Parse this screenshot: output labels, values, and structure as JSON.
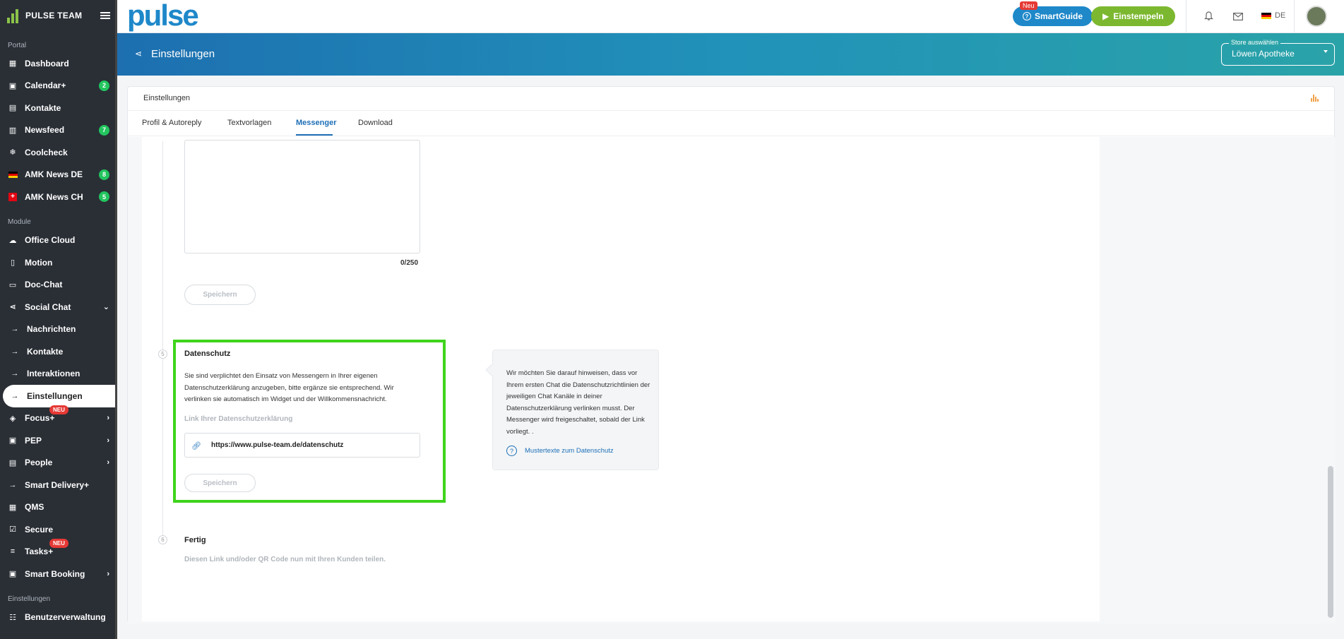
{
  "sidebar": {
    "brand": "PULSE TEAM",
    "sections": {
      "portal": "Portal",
      "module": "Module",
      "settings": "Einstellungen"
    },
    "portal_items": [
      {
        "label": "Dashboard",
        "icon": "dashboard-icon"
      },
      {
        "label": "Calendar+",
        "icon": "calendar-icon",
        "badge": "2"
      },
      {
        "label": "Kontakte",
        "icon": "contacts-icon"
      },
      {
        "label": "Newsfeed",
        "icon": "newsfeed-icon",
        "badge": "7"
      },
      {
        "label": "Coolcheck",
        "icon": "snowflake-icon"
      },
      {
        "label": "AMK News DE",
        "icon": "flag-de-icon",
        "badge": "8"
      },
      {
        "label": "AMK News CH",
        "icon": "flag-ch-icon",
        "badge": "5"
      }
    ],
    "module_items": [
      {
        "label": "Office Cloud",
        "icon": "cloud-icon"
      },
      {
        "label": "Motion",
        "icon": "phone-icon"
      },
      {
        "label": "Doc-Chat",
        "icon": "chat-icon"
      },
      {
        "label": "Social Chat",
        "icon": "share-icon"
      },
      {
        "label": "Nachrichten",
        "icon": "arrow-right-icon"
      },
      {
        "label": "Kontakte",
        "icon": "arrow-right-icon"
      },
      {
        "label": "Interaktionen",
        "icon": "arrow-right-icon"
      },
      {
        "label": "Einstellungen",
        "icon": "arrow-right-icon"
      },
      {
        "label": "Focus+",
        "icon": "focus-icon",
        "new": "NEU"
      },
      {
        "label": "PEP",
        "icon": "pep-icon"
      },
      {
        "label": "People",
        "icon": "people-icon"
      },
      {
        "label": "Smart Delivery+",
        "icon": "arrow-right-icon"
      },
      {
        "label": "QMS",
        "icon": "qms-icon"
      },
      {
        "label": "Secure",
        "icon": "secure-icon"
      },
      {
        "label": "Tasks+",
        "icon": "tasks-icon",
        "new": "NEU"
      },
      {
        "label": "Smart Booking",
        "icon": "booking-icon"
      }
    ],
    "settings_items": [
      {
        "label": "Benutzerverwaltung",
        "icon": "users-icon"
      }
    ]
  },
  "topbar": {
    "logo": "pulse",
    "smartguide_label": "SmartGuide",
    "smartguide_badge": "Neu",
    "clock_in_label": "Einstempeln",
    "language": "DE"
  },
  "header": {
    "title": "Einstellungen",
    "store_label": "Store auswählen",
    "store_value": "Löwen Apotheke"
  },
  "card": {
    "title": "Einstellungen",
    "tabs": [
      {
        "label": "Profil & Autoreply"
      },
      {
        "label": "Textvorlagen"
      },
      {
        "label": "Messenger",
        "active": true
      },
      {
        "label": "Download"
      }
    ]
  },
  "messenger": {
    "counter": "0/250",
    "save_label": "Speichern",
    "privacy": {
      "step": "5",
      "title": "Datenschutz",
      "text": "Sie sind verplichtet den Einsatz von Messengern in Ihrer eigenen Datenschutzerklärung anzugeben, bitte ergänze sie entsprechend. Wir verlinken sie automatisch im Widget und der Willkommensnachricht.",
      "link_label": "Link Ihrer Datenschutzerklärung",
      "url_value": "https://www.pulse-team.de/datenschutz",
      "save_label": "Speichern"
    },
    "info": {
      "text": "Wir möchten Sie darauf hinweisen, dass vor Ihrem ersten Chat die Datenschutzrichtlinien der jeweiligen Chat Kanäle in deiner Datenschutzerklärung verlinken musst. Der Messenger wird freigeschaltet, sobald der Link vorliegt. .",
      "link": "Mustertexte zum Datenschutz"
    },
    "done": {
      "step": "6",
      "title": "Fertig",
      "text": "Diesen Link und/oder QR Code nun mit Ihren Kunden teilen."
    }
  }
}
